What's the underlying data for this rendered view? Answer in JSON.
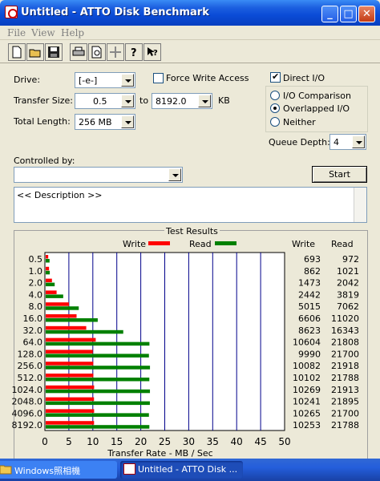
{
  "window": {
    "title": "Untitled - ATTO Disk Benchmark",
    "min": "_",
    "max": "□",
    "close": "✕"
  },
  "menu": {
    "file": "File",
    "view": "View",
    "help": "Help"
  },
  "toolbar": [
    "new-icon",
    "open-icon",
    "save-icon",
    "print-icon",
    "print-preview-icon",
    "move-icon",
    "help-icon",
    "context-help-icon"
  ],
  "form": {
    "drive_label": "Drive:",
    "drive_value": "[-e-]",
    "force_write": "Force Write Access",
    "direct_io": "Direct I/O",
    "transfer_label": "Transfer Size:",
    "transfer_from": "0.5",
    "to": "to",
    "transfer_to": "8192.0",
    "kb_unit": "KB",
    "io_comparison": "I/O Comparison",
    "overlapped_io": "Overlapped I/O",
    "neither": "Neither",
    "total_length_label": "Total Length:",
    "total_length_value": "256 MB",
    "queue_depth_label": "Queue Depth:",
    "queue_depth_value": "4",
    "controlled_by_label": "Controlled by:",
    "controlled_by_value": "",
    "start": "Start",
    "description": "<< Description >>"
  },
  "results": {
    "group_title": "Test Results",
    "legend_write": "Write",
    "legend_read": "Read",
    "col_write": "Write",
    "col_read": "Read"
  },
  "chart_data": {
    "type": "bar",
    "title": "Test Results",
    "xlabel": "Transfer Rate - MB / Sec",
    "xlim": [
      0,
      50
    ],
    "xticks": [
      "0",
      "5",
      "10",
      "15",
      "20",
      "25",
      "30",
      "35",
      "40",
      "45",
      "50"
    ],
    "categories": [
      "0.5",
      "1.0",
      "2.0",
      "4.0",
      "8.0",
      "16.0",
      "32.0",
      "64.0",
      "128.0",
      "256.0",
      "512.0",
      "1024.0",
      "2048.0",
      "4096.0",
      "8192.0"
    ],
    "series": [
      {
        "name": "Write",
        "color": "#ff0000",
        "values": [
          693,
          862,
          1473,
          2442,
          5015,
          6606,
          8623,
          10604,
          9990,
          10082,
          10102,
          10269,
          10241,
          10265,
          10253
        ]
      },
      {
        "name": "Read",
        "color": "#008000",
        "values": [
          972,
          1021,
          2042,
          3819,
          7062,
          11020,
          16343,
          21808,
          21700,
          21918,
          21788,
          21913,
          21895,
          21700,
          21788
        ]
      }
    ],
    "value_scale": "KB/s values; bar length in MB/s = value/1000",
    "legend": "top",
    "grid": true
  },
  "taskbar": [
    {
      "title": "Windows照相機"
    },
    {
      "title": "Untitled - ATTO Disk ..."
    }
  ],
  "colors": {
    "titlebar": "#0a4bd6",
    "write": "#ff0000",
    "read": "#008000",
    "grid": "#00008b"
  }
}
